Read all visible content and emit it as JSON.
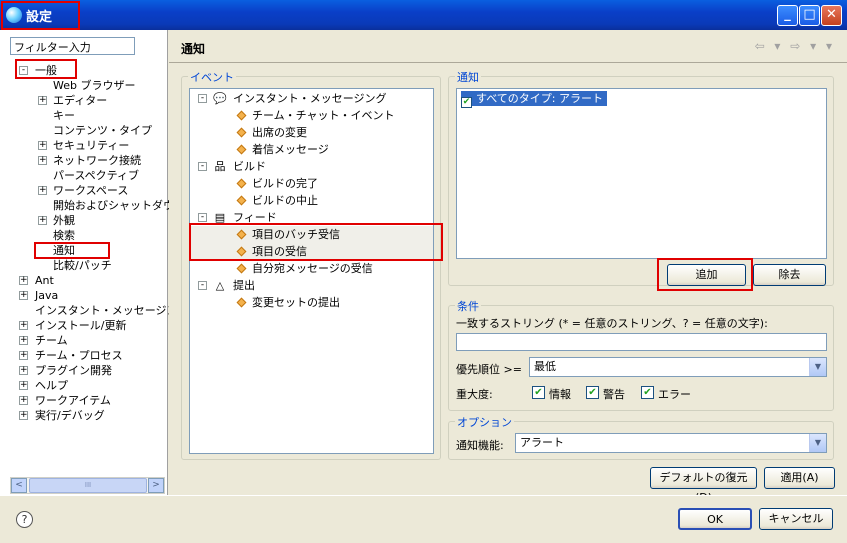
{
  "window": {
    "title": "設定",
    "minimize_glyph": "_",
    "maximize_glyph": "□",
    "close_glyph": "✕"
  },
  "filter": {
    "value": "フィルター入力"
  },
  "tree": [
    {
      "label": "一般",
      "level": 0,
      "expander": "-"
    },
    {
      "label": "Web ブラウザー",
      "level": 1,
      "expander": ""
    },
    {
      "label": "エディター",
      "level": 1,
      "expander": "+"
    },
    {
      "label": "キー",
      "level": 1,
      "expander": ""
    },
    {
      "label": "コンテンツ・タイプ",
      "level": 1,
      "expander": ""
    },
    {
      "label": "セキュリティー",
      "level": 1,
      "expander": "+"
    },
    {
      "label": "ネットワーク接続",
      "level": 1,
      "expander": "+"
    },
    {
      "label": "パースペクティブ",
      "level": 1,
      "expander": ""
    },
    {
      "label": "ワークスペース",
      "level": 1,
      "expander": "+"
    },
    {
      "label": "開始およびシャットダウン",
      "level": 1,
      "expander": ""
    },
    {
      "label": "外観",
      "level": 1,
      "expander": "+"
    },
    {
      "label": "検索",
      "level": 1,
      "expander": ""
    },
    {
      "label": "通知",
      "level": 1,
      "expander": ""
    },
    {
      "label": "比較/パッチ",
      "level": 1,
      "expander": ""
    },
    {
      "label": "Ant",
      "level": 0,
      "expander": "+"
    },
    {
      "label": "Java",
      "level": 0,
      "expander": "+"
    },
    {
      "label": "インスタント・メッセージング",
      "level": 0,
      "expander": ""
    },
    {
      "label": "インストール/更新",
      "level": 0,
      "expander": "+"
    },
    {
      "label": "チーム",
      "level": 0,
      "expander": "+"
    },
    {
      "label": "チーム・プロセス",
      "level": 0,
      "expander": "+"
    },
    {
      "label": "プラグイン開発",
      "level": 0,
      "expander": "+"
    },
    {
      "label": "ヘルプ",
      "level": 0,
      "expander": "+"
    },
    {
      "label": "ワークアイテム",
      "level": 0,
      "expander": "+"
    },
    {
      "label": "実行/デバッグ",
      "level": 0,
      "expander": "+"
    }
  ],
  "scroll": {
    "left": "<",
    "right": ">",
    "grip": "III"
  },
  "page": {
    "title": "通知",
    "nav": "⇦ ▾ ⇨ ▾ ▾"
  },
  "events": {
    "group_label": "イベント",
    "rows": [
      {
        "label": "インスタント・メッセージング",
        "kind": "category",
        "icon": "chat-icon",
        "glyph": "💬"
      },
      {
        "label": "チーム・チャット・イベント",
        "kind": "item"
      },
      {
        "label": "出席の変更",
        "kind": "item"
      },
      {
        "label": "着信メッセージ",
        "kind": "item"
      },
      {
        "label": "ビルド",
        "kind": "category",
        "icon": "build-icon",
        "glyph": "品"
      },
      {
        "label": "ビルドの完了",
        "kind": "item"
      },
      {
        "label": "ビルドの中止",
        "kind": "item"
      },
      {
        "label": "フィード",
        "kind": "category",
        "icon": "feed-icon",
        "glyph": "▤"
      },
      {
        "label": "項目のバッチ受信",
        "kind": "item"
      },
      {
        "label": "項目の受信",
        "kind": "item"
      },
      {
        "label": "自分宛メッセージの受信",
        "kind": "item"
      },
      {
        "label": "提出",
        "kind": "category",
        "icon": "delta-icon",
        "glyph": "△"
      },
      {
        "label": "変更セットの提出",
        "kind": "item"
      }
    ],
    "expander": "-"
  },
  "notifications": {
    "group_label": "通知",
    "items": [
      {
        "label": "すべてのタイプ: アラート",
        "checked": "✔"
      }
    ],
    "add_label": "追加",
    "remove_label": "除去"
  },
  "conditions": {
    "group_label": "条件",
    "match_label": "一致するストリング (* = 任意のストリング、? = 任意の文字):",
    "match_value": "",
    "priority_label": "優先順位 >=",
    "priority_value": "最低",
    "severity_label": "重大度:",
    "severities": [
      {
        "label": "情報",
        "checked": "✔"
      },
      {
        "label": "警告",
        "checked": "✔"
      },
      {
        "label": "エラー",
        "checked": "✔"
      }
    ]
  },
  "options": {
    "group_label": "オプション",
    "mechanism_label": "通知機能:",
    "mechanism_value": "アラート"
  },
  "actions": {
    "restore_defaults": "デフォルトの復元(D)",
    "apply": "適用(A)"
  },
  "footer": {
    "help_glyph": "?",
    "ok": "OK",
    "cancel": "キャンセル"
  },
  "combo_glyph": "▼",
  "colors": {
    "highlight": "#316ac5",
    "annotation_red": "#e00000",
    "group_label": "#0046d5"
  }
}
